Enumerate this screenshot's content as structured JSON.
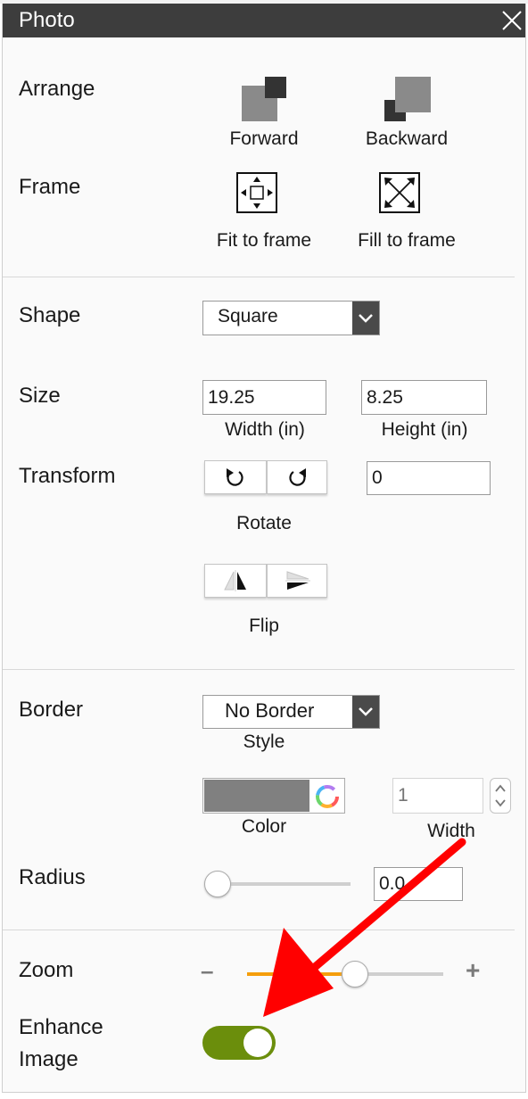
{
  "panel": {
    "title": "Photo"
  },
  "arrange": {
    "label": "Arrange",
    "forward_label": "Forward",
    "backward_label": "Backward"
  },
  "frame": {
    "label": "Frame",
    "fit_label": "Fit to frame",
    "fill_label": "Fill to frame"
  },
  "shape": {
    "label": "Shape",
    "value": "Square"
  },
  "size": {
    "label": "Size",
    "width_value": "19.25",
    "width_caption": "Width (in)",
    "height_value": "8.25",
    "height_caption": "Height (in)"
  },
  "transform": {
    "label": "Transform",
    "rotate_caption": "Rotate",
    "rotate_value": "0",
    "flip_caption": "Flip"
  },
  "border": {
    "label": "Border",
    "style_value": "No Border",
    "style_caption": "Style",
    "color_caption": "Color",
    "color_value": "#808080",
    "width_placeholder": "1",
    "width_caption": "Width"
  },
  "radius": {
    "label": "Radius",
    "value": "0.0",
    "slider_level": 0
  },
  "zoom": {
    "label": "Zoom",
    "slider_level": 0.55,
    "minus": "–",
    "plus": "+"
  },
  "enhance": {
    "label_line1": "Enhance",
    "label_line2": "Image",
    "enabled": true
  },
  "colors": {
    "titlebar": "#3d3d3d",
    "toggle_on": "#6b8e0c",
    "zoom_fill": "#f59e0b",
    "annotation_arrow": "#ff0000"
  }
}
